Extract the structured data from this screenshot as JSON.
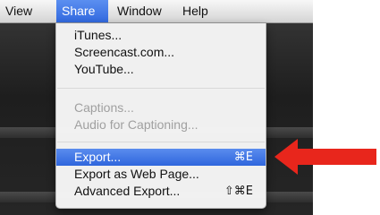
{
  "menubar": {
    "items": [
      {
        "label": "View"
      },
      {
        "label": "Share"
      },
      {
        "label": "Window"
      },
      {
        "label": "Help"
      }
    ]
  },
  "share_menu": {
    "group1": [
      {
        "label": "iTunes..."
      },
      {
        "label": "Screencast.com..."
      },
      {
        "label": "YouTube..."
      }
    ],
    "group2": [
      {
        "label": "Captions...",
        "disabled": true
      },
      {
        "label": "Audio for Captioning...",
        "disabled": true
      }
    ],
    "group3": [
      {
        "label": "Export...",
        "shortcut": "⌘E",
        "selected": true
      },
      {
        "label": "Export as Web Page...",
        "shortcut": ""
      },
      {
        "label": "Advanced Export...",
        "shortcut": "⇧⌘E"
      }
    ]
  },
  "colors": {
    "highlight": "#3269df",
    "arrow": "#e8261c"
  },
  "annotation": {
    "icon": "red-arrow-pointing-left"
  }
}
